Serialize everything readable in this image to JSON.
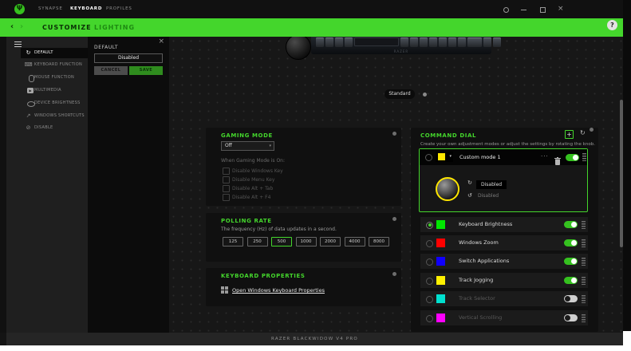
{
  "window": {
    "app_tabs": [
      {
        "label": "SYNAPSE",
        "active": false
      },
      {
        "label": "KEYBOARD",
        "active": true
      },
      {
        "label": "PROFILES",
        "active": false
      }
    ],
    "subnav": {
      "tabs": [
        {
          "label": "CUSTOMIZE",
          "active": true
        },
        {
          "label": "LIGHTING",
          "active": false
        }
      ],
      "help": "?"
    },
    "footer_device": "RAZER BLACKWIDOW V4 PRO"
  },
  "sidebar": {
    "items": [
      {
        "label": "DEFAULT",
        "active": true
      },
      {
        "label": "KEYBOARD FUNCTION",
        "active": false
      },
      {
        "label": "MOUSE FUNCTION",
        "active": false
      },
      {
        "label": "MULTIMEDIA",
        "active": false
      },
      {
        "label": "DEVICE BRIGHTNESS",
        "active": false
      },
      {
        "label": "WINDOWS SHORTCUTS",
        "active": false
      },
      {
        "label": "DISABLE",
        "active": false
      }
    ]
  },
  "assign_panel": {
    "title": "DEFAULT",
    "value": "Disabled",
    "cancel_label": "CANCEL",
    "save_label": "SAVE"
  },
  "device_view": {
    "layout_badge": "Standard",
    "brand": "RAZER"
  },
  "gaming_mode": {
    "title": "GAMING MODE",
    "selected": "Off",
    "when_on_label": "When Gaming Mode is On:",
    "options": [
      "Disable Windows Key",
      "Disable Menu Key",
      "Disable Alt + Tab",
      "Disable Alt + F4"
    ]
  },
  "polling_rate": {
    "title": "POLLING RATE",
    "description": "The frequency (Hz) of data updates in a second.",
    "rates": [
      "125",
      "250",
      "500",
      "1000",
      "2000",
      "4000",
      "8000"
    ],
    "selected": "500"
  },
  "keyboard_properties": {
    "title": "KEYBOARD PROPERTIES",
    "link_label": "Open Windows Keyboard Properties"
  },
  "command_dial": {
    "title": "COMMAND DIAL",
    "description": "Create your own adjustment modes or adjust the settings by rotating the knob.",
    "custom_mode": {
      "name": "Custom mode 1",
      "color": "#ffe600",
      "clockwise": "Disabled",
      "counterclockwise": "Disabled",
      "enabled": true
    },
    "modes": [
      {
        "name": "Keyboard Brightness",
        "color": "#00e700",
        "enabled": true,
        "selected": true
      },
      {
        "name": "Windows Zoom",
        "color": "#ff0000",
        "enabled": true,
        "selected": false
      },
      {
        "name": "Switch Applications",
        "color": "#1000ff",
        "enabled": true,
        "selected": false
      },
      {
        "name": "Track Jogging",
        "color": "#fff000",
        "enabled": true,
        "selected": false
      },
      {
        "name": "Track Selector",
        "color": "#00e0cf",
        "enabled": false,
        "selected": false
      },
      {
        "name": "Vertical Scrolling",
        "color": "#ff00ff",
        "enabled": false,
        "selected": false
      }
    ]
  },
  "colors": {
    "accent": "#44d62c"
  },
  "icons": {
    "logo": "Ψ",
    "back": "‹",
    "forward": "›",
    "close": "×",
    "more": "···",
    "chevron_down": "▾",
    "refresh": "↻",
    "add": "+",
    "rotate_cw": "↻",
    "rotate_ccw": "↺",
    "default": "↻",
    "keyboard": "⌨",
    "shortcut": "↗",
    "disable": "⊘",
    "play": "▶",
    "help": "?"
  }
}
